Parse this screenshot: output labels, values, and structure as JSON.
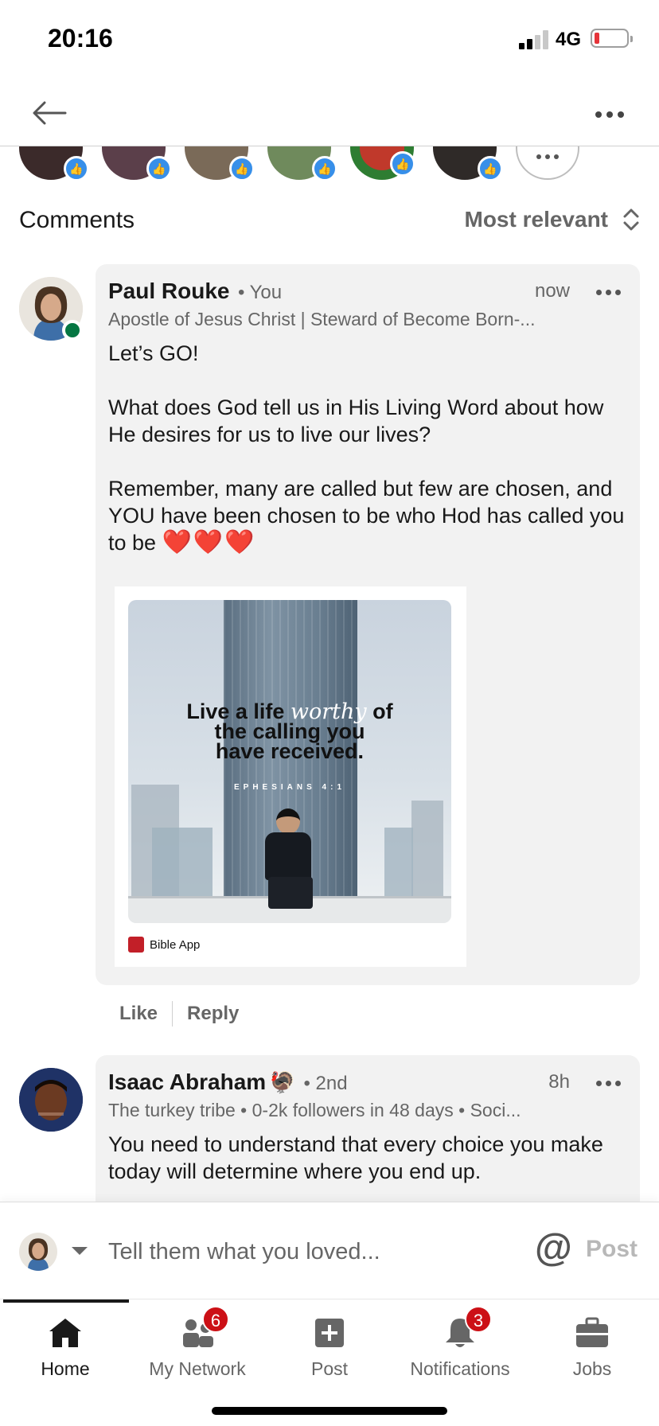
{
  "status_bar": {
    "time": "20:16",
    "network": "4G"
  },
  "header": {
    "back_icon": "arrow-left-icon",
    "more_icon": "more-horizontal-icon"
  },
  "reactors": [
    {
      "avatar_color": "#3b2a2a"
    },
    {
      "avatar_color": "#5b3f4a"
    },
    {
      "avatar_color": "#7a6a58"
    },
    {
      "avatar_color": "#6f8a5c"
    },
    {
      "avatar_color": "#c0392b"
    },
    {
      "avatar_color": "#2f2a28"
    }
  ],
  "comments_section": {
    "title": "Comments",
    "sort_label": "Most relevant"
  },
  "comments": [
    {
      "name": "Paul Rouke",
      "degree": "• You",
      "time": "now",
      "headline": "Apostle of Jesus Christ | Steward of Become Born-...",
      "body": "Let’s GO!\n\nWhat does God tell us in His Living Word about how He desires for us to live our lives?\n\nRemember, many are called but few are chosen, and YOU have been chosen to be who Hod has called you to be",
      "hearts": "❤️❤️❤️",
      "attachment": {
        "quote_line1_pre": "Live a life ",
        "quote_word": "worthy",
        "quote_line1_post": " of",
        "quote_line2": "the calling you",
        "quote_line3": "have received.",
        "reference": "EPHESIANS 4:1",
        "source": "Bible App"
      }
    },
    {
      "name": "Isaac Abraham",
      "name_emoji": "🦃",
      "degree": "• 2nd",
      "time": "8h",
      "headline": "The turkey tribe • 0-2k followers in 48 days • Soci...",
      "body": "You need to understand that every choice you make today will determine where you end up."
    }
  ],
  "comment_actions": {
    "like": "Like",
    "reply": "Reply"
  },
  "composer": {
    "placeholder": "Tell them what you loved...",
    "mention": "@",
    "post": "Post"
  },
  "tabs": [
    {
      "label": "Home",
      "icon": "home-icon",
      "badge": ""
    },
    {
      "label": "My Network",
      "icon": "network-icon",
      "badge": "6"
    },
    {
      "label": "Post",
      "icon": "post-icon",
      "badge": ""
    },
    {
      "label": "Notifications",
      "icon": "bell-icon",
      "badge": "3"
    },
    {
      "label": "Jobs",
      "icon": "briefcase-icon",
      "badge": ""
    }
  ],
  "colors": {
    "accent": "#378fe9",
    "badge": "#cc1016",
    "online": "#057642",
    "bubble": "#f2f2f2"
  }
}
